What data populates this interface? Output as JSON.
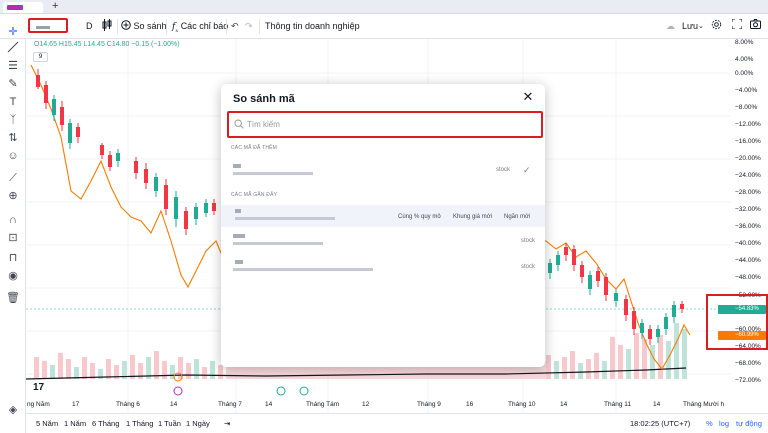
{
  "browser": {
    "new_tab": "+"
  },
  "toolbar": {
    "interval": "D",
    "compare": "So sánh",
    "indicators": "Các chỉ báo",
    "company_info": "Thông tin doanh nghiệp",
    "save": "Lưu"
  },
  "legend": {
    "ohlc": "O14.65  H15.45  L14.45  C14.80  −0.15 (−1.00%)",
    "interval_chip": "9"
  },
  "y_axis": [
    "8.00%",
    "4.00%",
    "0.00%",
    "−4.00%",
    "−8.00%",
    "−12.00%",
    "−16.00%",
    "−20.00%",
    "−24.00%",
    "−28.00%",
    "−32.00%",
    "−36.00%",
    "−40.00%",
    "−44.00%",
    "−48.00%",
    "−52.00%",
    "−56.00%",
    "−60.00%",
    "−64.00%",
    "−68.00%",
    "−72.00%"
  ],
  "badges": {
    "teal": "−54.83%",
    "orange": "−60.99%",
    "teal_color": "#22ab94",
    "orange_color": "#f57c00"
  },
  "x_axis": [
    "ng Năm",
    "17",
    "Tháng 6",
    "14",
    "Tháng 7",
    "14",
    "Tháng Tám",
    "12",
    "Tháng 9",
    "16",
    "Tháng 10",
    "14",
    "Tháng 11",
    "14",
    "Tháng Mười h"
  ],
  "bottom_bar": {
    "ranges": [
      "5 Năm",
      "1 Năm",
      "6 Tháng",
      "1 Tháng",
      "1 Tuần",
      "1 Ngày"
    ],
    "time": "18:02:25 (UTC+7)",
    "percent": "%",
    "log": "log",
    "auto": "tự động"
  },
  "modal": {
    "title": "So sánh mã",
    "search_placeholder": "Tìm kiếm",
    "added_header": "CÁC MÃ ĐÃ THÊM",
    "recent_header": "CÁC MÃ GẦN ĐÂY",
    "added_rows": [
      {
        "type": "stock"
      }
    ],
    "recent_rows": [
      {
        "type": "",
        "actions": [
          "Cùng % quy mô",
          "Khung giá mới",
          "Ngăn mới"
        ]
      },
      {
        "type": "stock"
      },
      {
        "type": "stock"
      }
    ]
  },
  "colors": {
    "up": "#22ab94",
    "down": "#f23645",
    "compare_line": "#f57c00",
    "volume_line": "#131722",
    "highlight_border": "#d81e1e"
  },
  "icons": [
    "crosshair-icon",
    "trend-line-icon",
    "fib-icon",
    "brush-icon",
    "text-icon",
    "pattern-icon",
    "forecast-icon",
    "emoji-icon",
    "ruler-icon",
    "zoom-in-icon",
    "magnet-icon",
    "lock-drawing-icon",
    "eye-icon",
    "trash-icon",
    "object-tree-icon",
    "search-icon",
    "close-icon",
    "check-icon",
    "settings-icon",
    "fullscreen-icon",
    "camera-icon",
    "undo-icon",
    "redo-icon",
    "cloud-icon"
  ]
}
